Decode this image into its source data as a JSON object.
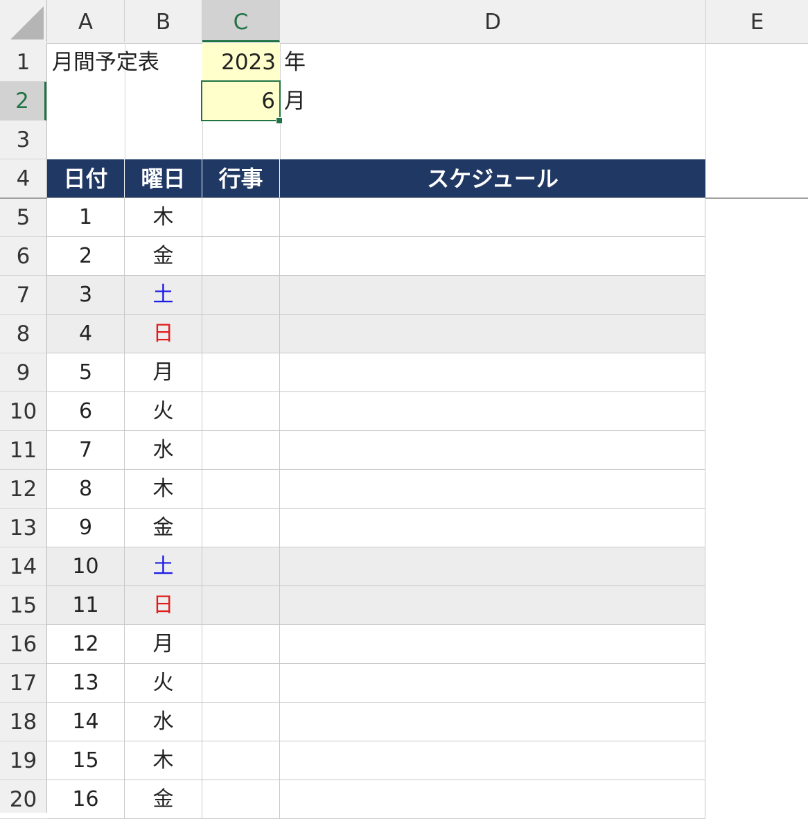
{
  "columns": [
    "A",
    "B",
    "C",
    "D",
    "E"
  ],
  "rows": [
    "1",
    "2",
    "3",
    "4",
    "5",
    "6",
    "7",
    "8",
    "9",
    "10",
    "11",
    "12",
    "13",
    "14",
    "15",
    "16",
    "17",
    "18",
    "19",
    "20"
  ],
  "selected_column": "C",
  "selected_row": "2",
  "title": "月間予定表",
  "year_value": "2023",
  "year_unit": "年",
  "month_value": "6",
  "month_unit": "月",
  "table_headers": {
    "date": "日付",
    "weekday": "曜日",
    "event": "行事",
    "schedule": "スケジュール"
  },
  "table_rows": [
    {
      "date": "1",
      "weekday": "木",
      "type": "weekday"
    },
    {
      "date": "2",
      "weekday": "金",
      "type": "weekday"
    },
    {
      "date": "3",
      "weekday": "土",
      "type": "saturday"
    },
    {
      "date": "4",
      "weekday": "日",
      "type": "sunday"
    },
    {
      "date": "5",
      "weekday": "月",
      "type": "weekday"
    },
    {
      "date": "6",
      "weekday": "火",
      "type": "weekday"
    },
    {
      "date": "7",
      "weekday": "水",
      "type": "weekday"
    },
    {
      "date": "8",
      "weekday": "木",
      "type": "weekday"
    },
    {
      "date": "9",
      "weekday": "金",
      "type": "weekday"
    },
    {
      "date": "10",
      "weekday": "土",
      "type": "saturday"
    },
    {
      "date": "11",
      "weekday": "日",
      "type": "sunday"
    },
    {
      "date": "12",
      "weekday": "月",
      "type": "weekday"
    },
    {
      "date": "13",
      "weekday": "火",
      "type": "weekday"
    },
    {
      "date": "14",
      "weekday": "水",
      "type": "weekday"
    },
    {
      "date": "15",
      "weekday": "木",
      "type": "weekday"
    },
    {
      "date": "16",
      "weekday": "金",
      "type": "weekday"
    }
  ],
  "colors": {
    "header_fill": "#203864",
    "input_fill": "#ffffcc",
    "weekend_fill": "#ededed",
    "saturday_text": "#1a1ae6",
    "sunday_text": "#e01b1b",
    "selection": "#217346"
  }
}
